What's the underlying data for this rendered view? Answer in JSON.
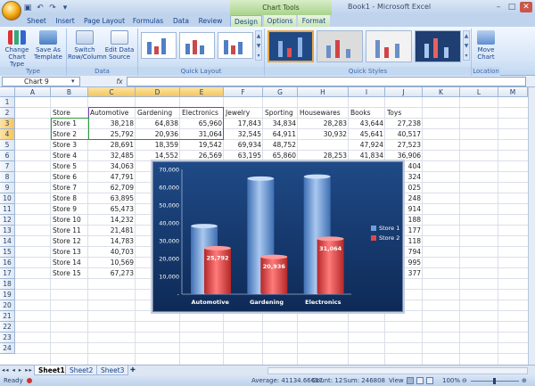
{
  "window": {
    "title": "Book1 - Microsoft Excel",
    "context_tab_group": "Chart Tools"
  },
  "tabs": [
    "Sheet",
    "Insert",
    "Page Layout",
    "Formulas",
    "Data",
    "Review",
    "Design",
    "Options",
    "Format"
  ],
  "active_tab": "Design",
  "ribbon": {
    "type_group": {
      "label": "Type",
      "change_chart_type": "Change Chart Type",
      "save_template": "Save As Template"
    },
    "data_group": {
      "label": "Data",
      "switch_row_column": "Switch Row/Column",
      "edit_data_source": "Edit Data Source"
    },
    "quick_layout_group": {
      "label": "Quick Layout"
    },
    "quick_styles_group": {
      "label": "Quick Styles"
    },
    "location_group": {
      "label": "Location",
      "move_chart": "Move Chart"
    }
  },
  "formula_bar": {
    "name_box": "Chart 9",
    "fx": "fx",
    "formula": ""
  },
  "columns": [
    "A",
    "B",
    "C",
    "D",
    "E",
    "F",
    "G",
    "H",
    "I",
    "J",
    "K",
    "L",
    "M"
  ],
  "rows": [
    "1",
    "2",
    "3",
    "4",
    "5",
    "6",
    "7",
    "8",
    "9",
    "10",
    "11",
    "12",
    "13",
    "14",
    "15",
    "16",
    "17",
    "18",
    "19",
    "20",
    "21",
    "22",
    "23",
    "24"
  ],
  "sheet": {
    "header": [
      "Store",
      "Automotive",
      "Gardening",
      "Electronics",
      "Jewelry",
      "Sporting",
      "Housewares",
      "Books",
      "Toys"
    ],
    "data": [
      [
        "Store 1",
        "38,218",
        "64,838",
        "65,960",
        "17,843",
        "34,834",
        "28,283",
        "43,644",
        "27,238"
      ],
      [
        "Store 2",
        "25,792",
        "20,936",
        "31,064",
        "32,545",
        "64,911",
        "30,932",
        "45,641",
        "40,517"
      ],
      [
        "Store 3",
        "28,691",
        "18,359",
        "19,542",
        "69,934",
        "48,752",
        "",
        "47,924",
        "27,523"
      ],
      [
        "Store 4",
        "32,485",
        "14,552",
        "26,569",
        "63,195",
        "65,860",
        "28,253",
        "41,834",
        "36,906"
      ],
      [
        "Store 5",
        "34,063",
        "",
        "",
        "",
        "",
        "",
        "",
        "404"
      ],
      [
        "Store 6",
        "47,791",
        "",
        "",
        "",
        "",
        "",
        "",
        "324"
      ],
      [
        "Store 7",
        "62,709",
        "",
        "",
        "",
        "",
        "",
        "",
        "025"
      ],
      [
        "Store 8",
        "63,895",
        "",
        "",
        "",
        "",
        "",
        "",
        "248"
      ],
      [
        "Store 9",
        "65,473",
        "",
        "",
        "",
        "",
        "",
        "",
        "914"
      ],
      [
        "Store 10",
        "14,232",
        "",
        "",
        "",
        "",
        "",
        "",
        "188"
      ],
      [
        "Store 11",
        "21,481",
        "",
        "",
        "",
        "",
        "",
        "",
        "177"
      ],
      [
        "Store 12",
        "14,783",
        "",
        "",
        "",
        "",
        "",
        "",
        "118"
      ],
      [
        "Store 13",
        "40,703",
        "",
        "",
        "",
        "",
        "",
        "",
        "794"
      ],
      [
        "Store 14",
        "10,569",
        "",
        "",
        "",
        "",
        "",
        "",
        "995"
      ],
      [
        "Store 15",
        "67,273",
        "",
        "",
        "",
        "",
        "",
        "",
        "377"
      ]
    ]
  },
  "chart_data": {
    "type": "bar",
    "categories": [
      "Automotive",
      "Gardening",
      "Electronics"
    ],
    "series": [
      {
        "name": "Store 1",
        "values": [
          38218,
          64838,
          65960
        ],
        "color": "#6f9fd8"
      },
      {
        "name": "Store 2",
        "values": [
          25792,
          20936,
          31064
        ],
        "color": "#e04848",
        "labels": [
          "25,792",
          "20,936",
          "31,064"
        ]
      }
    ],
    "y_ticks": [
      "-",
      "10,000",
      "20,000",
      "30,000",
      "40,000",
      "50,000",
      "60,000",
      "70,000"
    ],
    "ylim": [
      0,
      70000
    ],
    "legend": "right",
    "grid": false
  },
  "sheet_tabs": [
    "Sheet1",
    "Sheet2",
    "Sheet3"
  ],
  "active_sheet": "Sheet1",
  "status": {
    "ready": "Ready",
    "average": "Average: 41134.66667",
    "count": "Count: 12",
    "sum": "Sum: 246808",
    "view": "View",
    "zoom": "100%"
  }
}
